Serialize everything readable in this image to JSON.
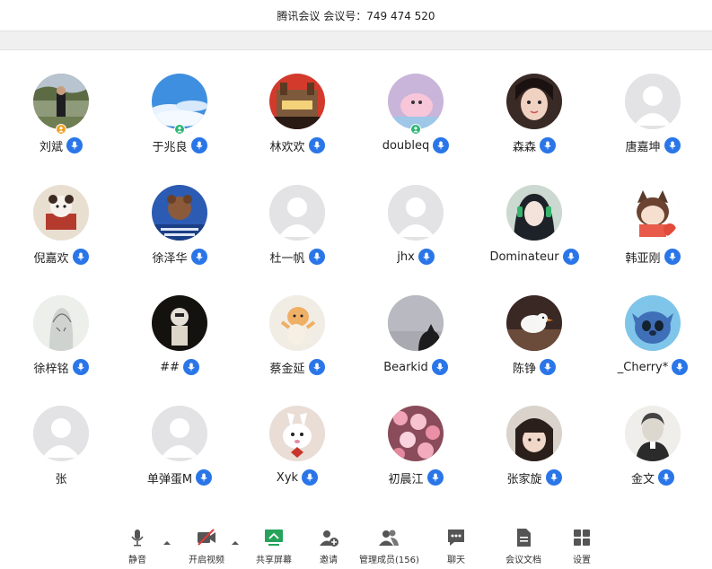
{
  "meeting": {
    "title": "腾讯会议 会议号：749 474 520"
  },
  "colors": {
    "mic_blue": "#2a76e8",
    "host_orange": "#f0a020",
    "cohost_green": "#2bb673",
    "placeholder": "#e3e3e6"
  },
  "participants": [
    {
      "name": "刘斌",
      "avatar": "photo-man-outdoor",
      "badge": "host"
    },
    {
      "name": "于兆良",
      "avatar": "photo-blue-sky",
      "badge": "cohost"
    },
    {
      "name": "林欢欢",
      "avatar": "photo-red-building",
      "badge": ""
    },
    {
      "name": "doubleq",
      "avatar": "cartoon-pink-seal",
      "badge": "cohost"
    },
    {
      "name": "森森",
      "avatar": "photo-girl",
      "badge": ""
    },
    {
      "name": "唐嘉坤",
      "avatar": "default",
      "badge": ""
    },
    {
      "name": "倪嘉欢",
      "avatar": "cartoon-dog-chair",
      "badge": ""
    },
    {
      "name": "徐泽华",
      "avatar": "cartoon-blue-poster",
      "badge": ""
    },
    {
      "name": "杜一帆",
      "avatar": "default",
      "badge": ""
    },
    {
      "name": "jhx",
      "avatar": "default",
      "badge": ""
    },
    {
      "name": "Dominateur",
      "avatar": "anime-headphones",
      "badge": ""
    },
    {
      "name": "韩亚刚",
      "avatar": "cartoon-cat-girl",
      "badge": ""
    },
    {
      "name": "徐梓铭",
      "avatar": "sketch-portrait",
      "badge": ""
    },
    {
      "name": "##",
      "avatar": "dark-figure",
      "badge": ""
    },
    {
      "name": "蔡金延",
      "avatar": "cartoon-cat-dance",
      "badge": ""
    },
    {
      "name": "Bearkid",
      "avatar": "photo-gray-cat",
      "badge": ""
    },
    {
      "name": "陈铮",
      "avatar": "photo-white-bird",
      "badge": ""
    },
    {
      "name": "_Cherry*",
      "avatar": "cartoon-stitch",
      "badge": ""
    },
    {
      "name": "张",
      "avatar": "default",
      "badge": "",
      "mic": false
    },
    {
      "name": "单弹蛋M",
      "avatar": "default",
      "badge": ""
    },
    {
      "name": "Xyk",
      "avatar": "cartoon-rabbit",
      "badge": ""
    },
    {
      "name": "初晨江",
      "avatar": "photo-pink-flowers",
      "badge": ""
    },
    {
      "name": "张家旋",
      "avatar": "photo-girl-bangs",
      "badge": ""
    },
    {
      "name": "金文",
      "avatar": "sketch-old-man",
      "badge": ""
    }
  ],
  "toolbar": [
    {
      "label": "静音",
      "icon": "microphone-icon",
      "caret": true
    },
    {
      "label": "开启视频",
      "icon": "video-off-icon",
      "caret": true
    },
    {
      "label": "共享屏幕",
      "icon": "share-screen-icon",
      "caret": false
    },
    {
      "label": "邀请",
      "icon": "invite-icon",
      "caret": false
    },
    {
      "label": "管理成员(156)",
      "icon": "members-icon",
      "caret": false
    },
    {
      "label": "聊天",
      "icon": "chat-icon",
      "caret": false
    },
    {
      "label": "会议文档",
      "icon": "document-icon",
      "caret": false
    },
    {
      "label": "设置",
      "icon": "settings-icon",
      "caret": false
    }
  ]
}
